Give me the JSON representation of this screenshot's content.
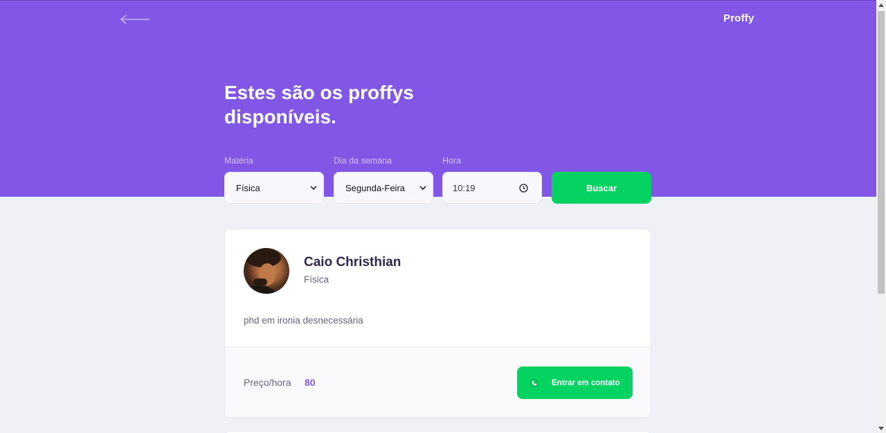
{
  "header": {
    "logo": "Proffy",
    "title": "Estes são os proffys disponíveis."
  },
  "filters": {
    "subject": {
      "label": "Matéria",
      "value": "Física"
    },
    "weekday": {
      "label": "Dia da semana",
      "value": "Segunda-Feira"
    },
    "time": {
      "label": "Hora",
      "value": "10:19"
    },
    "search_label": "Buscar"
  },
  "teacher": {
    "name": "Caio Christhian",
    "subject": "Física",
    "bio": "phd em ironia desnecessária",
    "price_label": "Preço/hora",
    "price": "80",
    "contact_label": "Entrar em contato"
  },
  "colors": {
    "primary": "#8257e5",
    "secondary": "#04d361",
    "background": "#f0f0f7"
  },
  "icons": {
    "back": "arrow-left-icon",
    "select": "chevron-down-icon",
    "time": "clock-icon",
    "contact": "whatsapp-icon"
  }
}
